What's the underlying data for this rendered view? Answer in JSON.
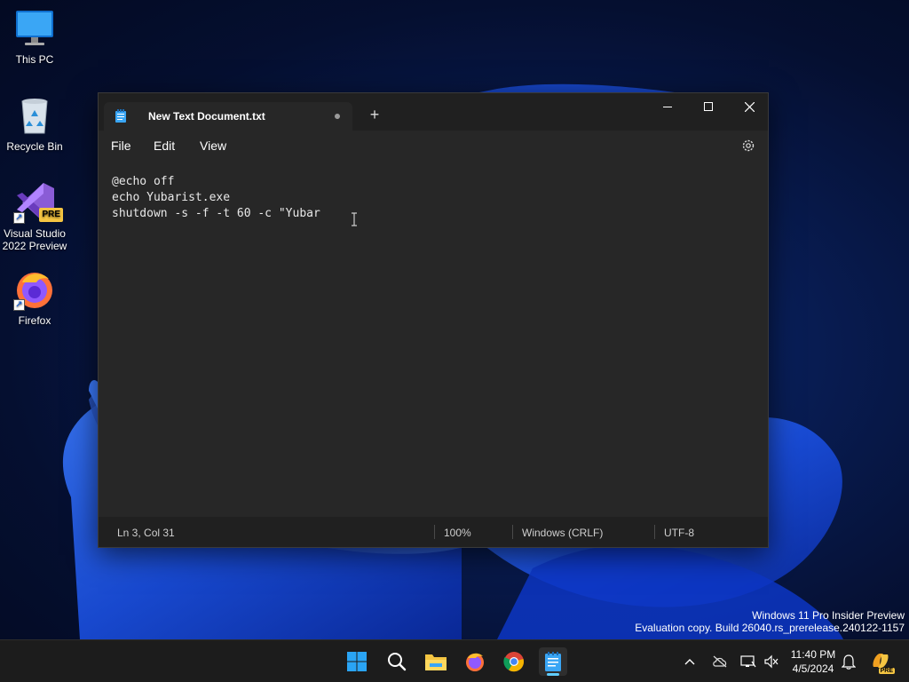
{
  "desktop": {
    "icons": [
      {
        "label": "This PC",
        "icon": "monitor-icon"
      },
      {
        "label": "Recycle Bin",
        "icon": "recycle-bin-icon"
      },
      {
        "label": "Visual Studio 2022 Preview",
        "line1": "Visual Studio",
        "line2": "2022 Preview",
        "badge": "PRE",
        "icon": "visual-studio-icon"
      },
      {
        "label": "Firefox",
        "icon": "firefox-icon"
      }
    ],
    "watermark": {
      "line1": "Windows 11 Pro Insider Preview",
      "line2": "Evaluation copy. Build 26040.rs_prerelease.240122-1157"
    }
  },
  "notepad": {
    "tab_title": "New Text Document.txt",
    "unsaved_indicator": true,
    "new_tab_label": "+",
    "menu": [
      "File",
      "Edit",
      "View"
    ],
    "content_lines": [
      "@echo off",
      "echo Yubarist.exe",
      "shutdown -s -f -t 60 -c \"Yubar"
    ],
    "status": {
      "position": "Ln 3, Col 31",
      "zoom": "100%",
      "line_ending": "Windows (CRLF)",
      "encoding": "UTF-8"
    }
  },
  "taskbar": {
    "apps": [
      "start-icon",
      "search-icon",
      "file-explorer-icon",
      "firefox-icon",
      "chrome-icon",
      "notepad-icon"
    ],
    "active_app": "notepad-icon",
    "clock": {
      "time": "11:40 PM",
      "date": "4/5/2024"
    },
    "tray": [
      "chevron-up-icon",
      "onedrive-icon",
      "network-icon",
      "volume-muted-icon",
      "notification-bell-icon",
      "copilot-icon"
    ],
    "copilot_badge": "PRE"
  },
  "colors": {
    "accent": "#60cdff",
    "window_bg": "#272727",
    "titlebar_bg": "#202020",
    "taskbar_bg": "#1c1c1c"
  }
}
